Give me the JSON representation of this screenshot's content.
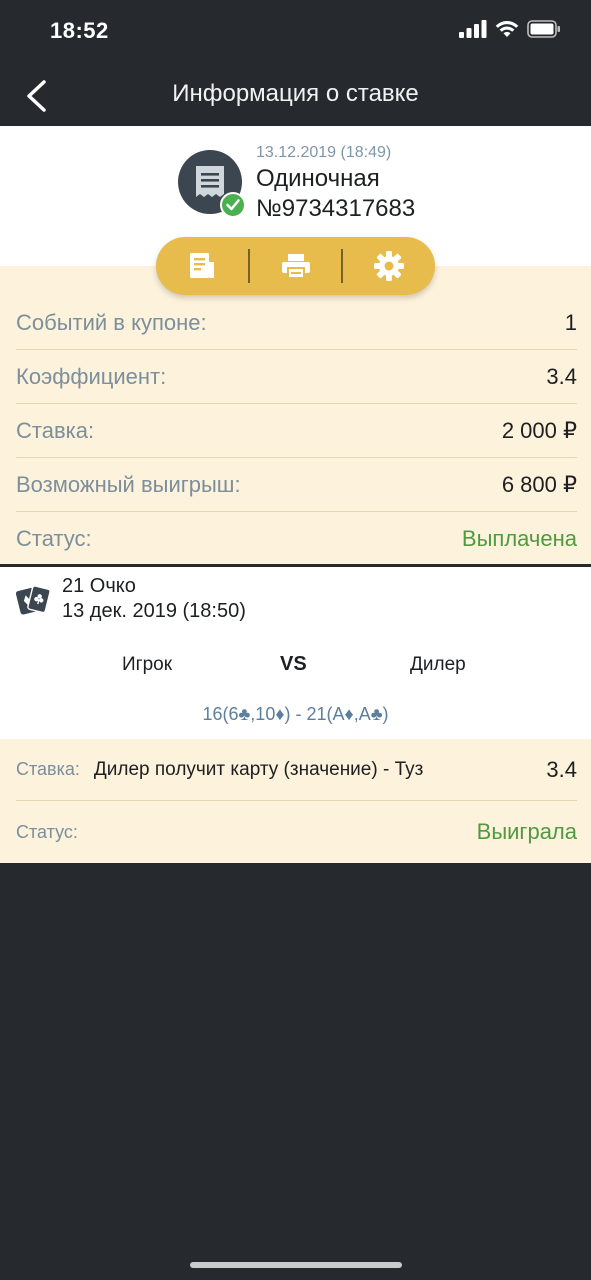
{
  "status_bar": {
    "time": "18:52"
  },
  "nav": {
    "title": "Информация о ставке"
  },
  "bet": {
    "date": "13.12.2019 (18:49)",
    "type": "Одиночная",
    "number": "№9734317683"
  },
  "actions": [
    {
      "icon": "document-icon"
    },
    {
      "icon": "printer-icon"
    },
    {
      "icon": "gear-icon"
    }
  ],
  "info": {
    "events": {
      "label": "Событий в купоне:",
      "value": "1"
    },
    "coef": {
      "label": "Коэффициент:",
      "value": "3.4"
    },
    "stake": {
      "label": "Ставка:",
      "value": "2 000 ₽"
    },
    "win": {
      "label": "Возможный выигрыш:",
      "value": "6 800 ₽"
    },
    "status": {
      "label": "Статус:",
      "value": "Выплачена"
    }
  },
  "event": {
    "name": "21 Очко",
    "date": "13 дек. 2019 (18:50)",
    "team_left": "Игрок",
    "vs": "VS",
    "team_right": "Дилер",
    "score": "16(6♣,10♦) - 21(A♦,A♣)"
  },
  "selection": {
    "stake_label": "Ставка:",
    "description": "Дилер получит карту (значение) - Туз",
    "odds": "3.4",
    "status_label": "Статус:",
    "status_value": "Выиграла"
  },
  "colors": {
    "background": "#262a2f",
    "panel": "#fdf2dc",
    "accent": "#e7bc4c",
    "green": "#4f9a3f",
    "label": "#7b8f9c"
  }
}
